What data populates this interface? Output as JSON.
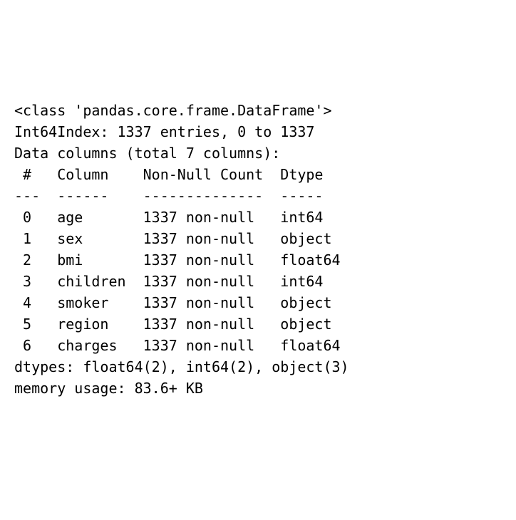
{
  "header": {
    "class_line": "<class 'pandas.core.frame.DataFrame'>",
    "index_line": "Int64Index: 1337 entries, 0 to 1337",
    "columns_header": "Data columns (total 7 columns):",
    "col_header_line": " #   Column    Non-Null Count  Dtype  ",
    "divider_line": "---  ------    --------------  -----  "
  },
  "rows": [
    {
      "line": " 0   age       1337 non-null   int64  "
    },
    {
      "line": " 1   sex       1337 non-null   object "
    },
    {
      "line": " 2   bmi       1337 non-null   float64"
    },
    {
      "line": " 3   children  1337 non-null   int64  "
    },
    {
      "line": " 4   smoker    1337 non-null   object "
    },
    {
      "line": " 5   region    1337 non-null   object "
    },
    {
      "line": " 6   charges   1337 non-null   float64"
    }
  ],
  "footer": {
    "dtypes_line": "dtypes: float64(2), int64(2), object(3)",
    "memory_line": "memory usage: 83.6+ KB"
  }
}
